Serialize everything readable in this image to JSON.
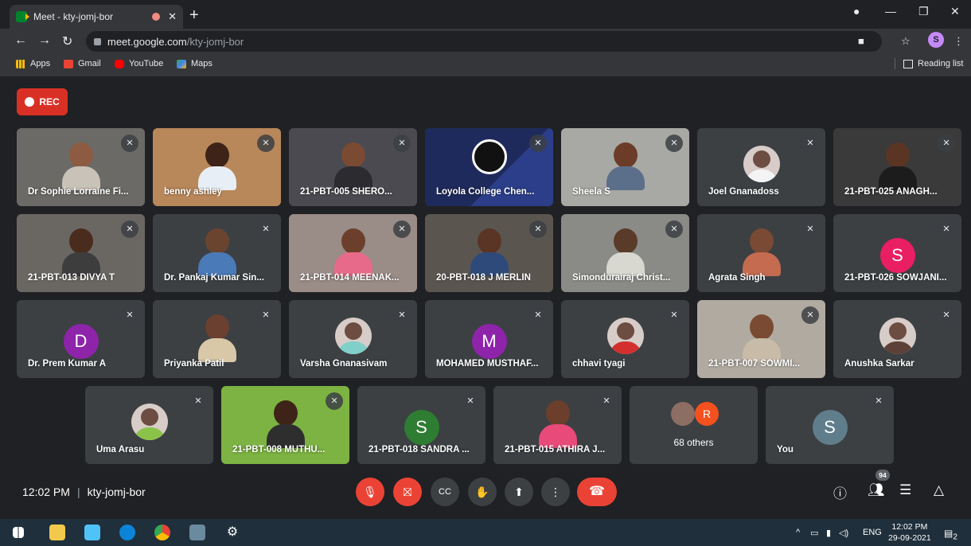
{
  "browser": {
    "tab_title": "Meet - kty-jomj-bor",
    "new_tab": "+",
    "url_host": "meet.google.com",
    "url_path": "/kty-jomj-bor",
    "profile_initial": "S",
    "bookmarks": [
      "Apps",
      "Gmail",
      "YouTube",
      "Maps"
    ],
    "reading_list": "Reading list"
  },
  "meet": {
    "rec_label": "REC",
    "participants": [
      {
        "name": "Dr Sophie Lorraine Fi...",
        "kind": "video",
        "bg": "#6b6a66",
        "skin": "#8d5b42",
        "shirt": "#c9c2b8"
      },
      {
        "name": "benny ashley",
        "kind": "video",
        "bg": "#b8875a",
        "skin": "#3e2418",
        "shirt": "#e8eef5"
      },
      {
        "name": "21-PBT-005 SHERO...",
        "kind": "video",
        "bg": "#4a4a50",
        "skin": "#7a4a32",
        "shirt": "#2b2b30"
      },
      {
        "name": "Loyola College Chen...",
        "kind": "obs",
        "bg": "#1f2a5c"
      },
      {
        "name": "Sheela S",
        "kind": "video",
        "bg": "#a8a8a4",
        "skin": "#6b3d28",
        "shirt": "#5c6f8a"
      },
      {
        "name": "Joel Gnanadoss",
        "kind": "photo",
        "bg": "#3c4043",
        "shirt": "#f4f4f4"
      },
      {
        "name": "21-PBT-025 ANAGH...",
        "kind": "video",
        "bg": "#3a3a3a",
        "skin": "#5a3524",
        "shirt": "#1c1c1c"
      },
      {
        "name": "21-PBT-013 DIVYA T",
        "kind": "video",
        "bg": "#6a6763",
        "skin": "#4a2c1e",
        "shirt": "#3d3d3d"
      },
      {
        "name": "Dr. Pankaj Kumar Sin...",
        "kind": "video",
        "bg": "#3c4043",
        "skin": "#6b4430",
        "shirt": "#4b7ab8"
      },
      {
        "name": "21-PBT-014 MEENAK...",
        "kind": "video",
        "bg": "#9a8c86",
        "skin": "#6b3f2c",
        "shirt": "#e86a8a"
      },
      {
        "name": "20-PBT-018 J MERLIN",
        "kind": "video",
        "bg": "#5b5550",
        "skin": "#5a3424",
        "shirt": "#2d4a7a"
      },
      {
        "name": "Simondurairaj Christ...",
        "kind": "video",
        "bg": "#8a8a86",
        "skin": "#5a3a28",
        "shirt": "#d8d8d0"
      },
      {
        "name": "Agrata Singh",
        "kind": "video",
        "bg": "#3c4043",
        "skin": "#7a4a34",
        "shirt": "#c46b50"
      },
      {
        "name": "21-PBT-026 SOWJANI...",
        "kind": "letter",
        "letter": "S",
        "color": "#e91e63"
      },
      {
        "name": "Dr. Prem Kumar A",
        "kind": "letter",
        "letter": "D",
        "color": "#8e24aa"
      },
      {
        "name": "Priyanka Patil",
        "kind": "video",
        "bg": "#3c4043",
        "skin": "#6b4030",
        "shirt": "#d8c8a8"
      },
      {
        "name": "Varsha Gnanasivam",
        "kind": "photo",
        "bg": "#3c4043",
        "shirt": "#7fd0c8"
      },
      {
        "name": "MOHAMED MUSTHAF...",
        "kind": "letter",
        "letter": "M",
        "color": "#8e24aa"
      },
      {
        "name": "chhavi tyagi",
        "kind": "photo",
        "bg": "#3c4043",
        "shirt": "#d32f2f"
      },
      {
        "name": "21-PBT-007 SOWMI...",
        "kind": "video",
        "bg": "#b0aaa0",
        "skin": "#7a4a32",
        "shirt": "#c8bca8"
      },
      {
        "name": "Anushka Sarkar",
        "kind": "photo",
        "bg": "#3c4043",
        "shirt": "#5d4037"
      },
      {
        "name": "Uma Arasu",
        "kind": "photo",
        "bg": "#3c4043",
        "shirt": "#8bc34a"
      },
      {
        "name": "21-PBT-008 MUTHU...",
        "kind": "video",
        "bg": "#7cb342",
        "skin": "#3e2418",
        "shirt": "#2e2e2e"
      },
      {
        "name": "21-PBT-018 SANDRA ...",
        "kind": "letter",
        "letter": "S",
        "color": "#2e7d32"
      },
      {
        "name": "21-PBT-015 ATHIRA J...",
        "kind": "video",
        "bg": "#3c4043",
        "skin": "#6b3f2c",
        "shirt": "#e84a7a"
      },
      {
        "name": "68 others",
        "kind": "others",
        "letter": "R",
        "color": "#f4511e"
      },
      {
        "name": "You",
        "kind": "letter",
        "letter": "S",
        "color": "#607d8b"
      }
    ]
  },
  "bottom": {
    "time": "12:02 PM",
    "separator": "|",
    "meeting_code": "kty-jomj-bor",
    "participant_count": "94"
  },
  "taskbar": {
    "lang": "ENG",
    "clock_time": "12:02 PM",
    "clock_date": "29-09-2021",
    "notif": "2"
  }
}
